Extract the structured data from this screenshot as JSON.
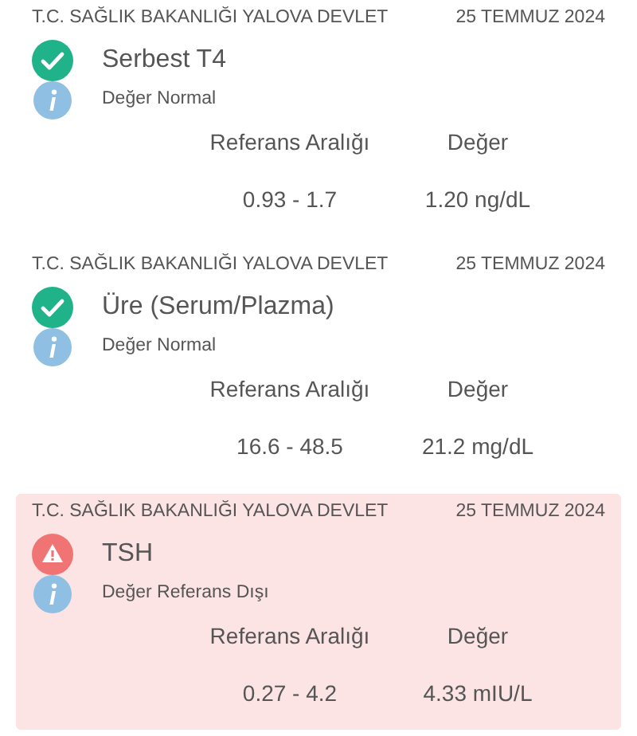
{
  "results": [
    {
      "institution": "T.C. SAĞLIK BAKANLIĞI YALOVA DEVLET",
      "date": "25 TEMMUZ 2024",
      "test": "Serbest T4",
      "kind": "ok",
      "note": "Değer Normal",
      "range_label": "Referans Aralığı",
      "value_label": "Değer",
      "range": "0.93 - 1.7",
      "value": "1.20 ng/dL"
    },
    {
      "institution": "T.C. SAĞLIK BAKANLIĞI YALOVA DEVLET",
      "date": "25 TEMMUZ 2024",
      "test": "Üre (Serum/Plazma)",
      "kind": "ok",
      "note": "Değer Normal",
      "range_label": "Referans Aralığı",
      "value_label": "Değer",
      "range": "16.6 - 48.5",
      "value": "21.2 mg/dL"
    },
    {
      "institution": "T.C. SAĞLIK BAKANLIĞI YALOVA DEVLET",
      "date": "25 TEMMUZ 2024",
      "test": "TSH",
      "kind": "alert",
      "note": "Değer Referans Dışı",
      "range_label": "Referans Aralığı",
      "value_label": "Değer",
      "range": "0.27 - 4.2",
      "value": "4.33 mIU/L"
    }
  ]
}
